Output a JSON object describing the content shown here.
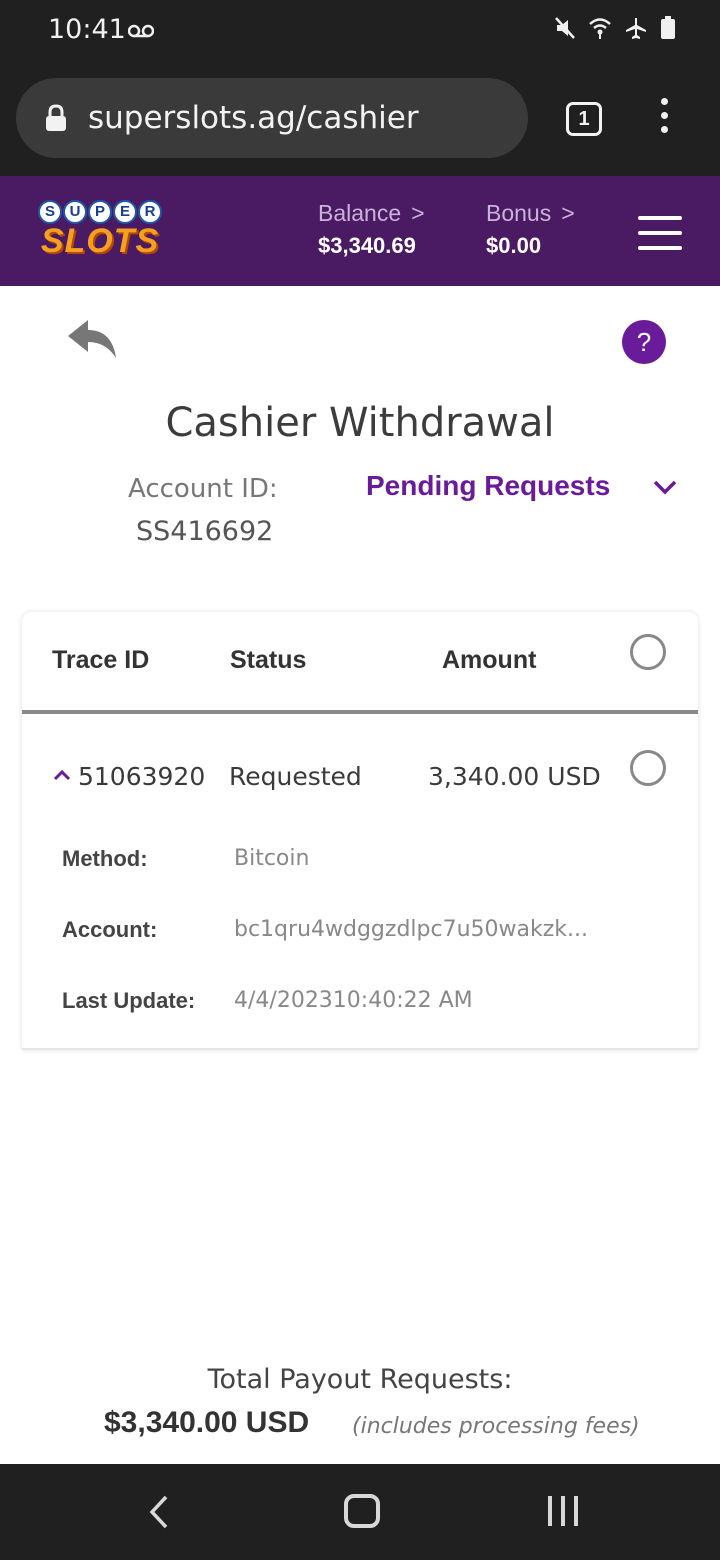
{
  "status_bar": {
    "time": "10:41",
    "icons": [
      "voicemail-icon",
      "mute-icon",
      "wifi-icon",
      "airplane-icon",
      "battery-icon"
    ]
  },
  "browser": {
    "url": "superslots.ag/cashier",
    "tab_count": "1"
  },
  "site_header": {
    "logo_super": [
      "S",
      "U",
      "P",
      "E",
      "R"
    ],
    "logo_slots": "SLOTS",
    "balance_label": "Balance",
    "balance_value": "$3,340.69",
    "bonus_label": "Bonus",
    "bonus_value": "$0.00",
    "chevron": ">"
  },
  "page": {
    "help_label": "?",
    "title": "Cashier Withdrawal",
    "account_label": "Account ID:",
    "account_id": "SS416692",
    "filter_label": "Pending Requests"
  },
  "table": {
    "columns": [
      "Trace ID",
      "Status",
      "Amount"
    ],
    "rows": [
      {
        "trace_id": "51063920",
        "status": "Requested",
        "amount": "3,340.00 USD",
        "details": [
          {
            "label": "Method:",
            "value": "Bitcoin"
          },
          {
            "label": "Account:",
            "value": "bc1qru4wdggzdlpc7u50wakzk..."
          },
          {
            "label": "Last Update:",
            "value": "4/4/202310:40:22 AM"
          }
        ]
      }
    ]
  },
  "totals": {
    "label": "Total Payout Requests:",
    "amount": "$3,340.00 USD",
    "note": "(includes processing fees)"
  },
  "colors": {
    "header_bg": "#4a1a63",
    "accent_purple": "#6a1b9a",
    "system_bar": "#202020"
  }
}
